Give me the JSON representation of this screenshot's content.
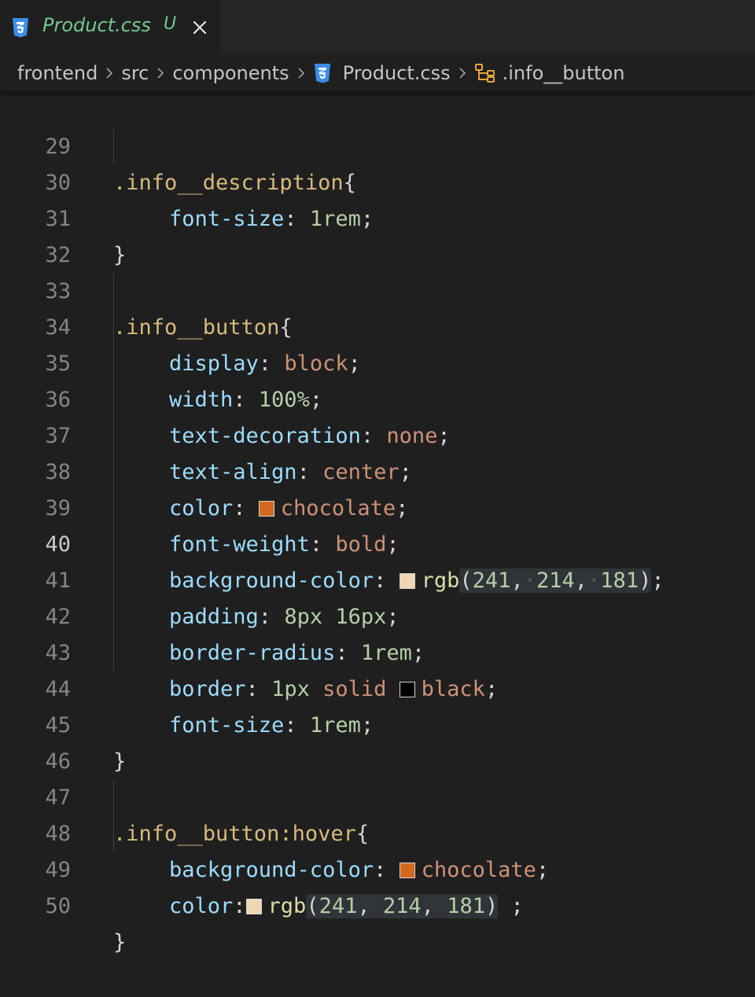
{
  "tab": {
    "filename": "Product.css",
    "status": "U"
  },
  "breadcrumb": {
    "items": [
      "frontend",
      "src",
      "components",
      "Product.css",
      ".info__button"
    ]
  },
  "editor": {
    "active_line": "40",
    "lines": [
      {
        "n": "29",
        "sel": ".info__description",
        "open": "{"
      },
      {
        "n": "30",
        "prop": "font-size",
        "val": "1rem"
      },
      {
        "n": "31",
        "close": "}"
      },
      {
        "n": "32"
      },
      {
        "n": "33",
        "sel": ".info__button",
        "open": "{"
      },
      {
        "n": "34",
        "prop": "display",
        "val": "block"
      },
      {
        "n": "35",
        "prop": "width",
        "val": "100%"
      },
      {
        "n": "36",
        "prop": "text-decoration",
        "val": "none"
      },
      {
        "n": "37",
        "prop": "text-align",
        "val": "center"
      },
      {
        "n": "38",
        "prop": "color",
        "val": "chocolate",
        "swatch": "#d2691e"
      },
      {
        "n": "39",
        "prop": "font-weight",
        "val": "bold"
      },
      {
        "n": "40",
        "prop": "background-color",
        "fn": "rgb",
        "args": [
          "241",
          "214",
          "181"
        ],
        "swatch": "#f1d6b5"
      },
      {
        "n": "41",
        "prop": "padding",
        "val1": "8px",
        "val2": "16px"
      },
      {
        "n": "42",
        "prop": "border-radius",
        "val": "1rem"
      },
      {
        "n": "43",
        "prop": "border",
        "val1": "1px",
        "val2": "solid",
        "val3": "black",
        "swatch": "#000000"
      },
      {
        "n": "44",
        "prop": "font-size",
        "val": "1rem"
      },
      {
        "n": "45",
        "close": "}"
      },
      {
        "n": "46"
      },
      {
        "n": "47",
        "sel": ".info__button:hover",
        "open": "{"
      },
      {
        "n": "48",
        "prop": "background-color",
        "val": "chocolate",
        "swatch": "#d2691e"
      },
      {
        "n": "49",
        "prop": "color",
        "fn": "rgb",
        "args": [
          "241",
          "214",
          "181"
        ],
        "swatch": "#f1d6b5"
      },
      {
        "n": "50",
        "close": "}"
      }
    ]
  },
  "colors": {
    "css_icon": "#3b8eea",
    "modified_green": "#73c991",
    "symbol_icon": "#e8a33a"
  }
}
